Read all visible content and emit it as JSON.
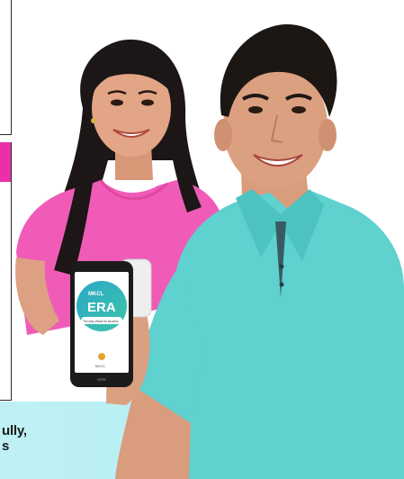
{
  "banner_text": {
    "line1": "ully,",
    "line2": "s"
  },
  "phone_app": {
    "brand_small": "MKCL",
    "brand_title": "ERA",
    "tagline": "The only choice for success",
    "footer_text": "MKCL"
  },
  "colors": {
    "pink_accent": "#ec2fa9",
    "cyan_band": "#b4eef3",
    "shirt_teal": "#5fd1cf",
    "top_pink": "#f05bb8"
  }
}
